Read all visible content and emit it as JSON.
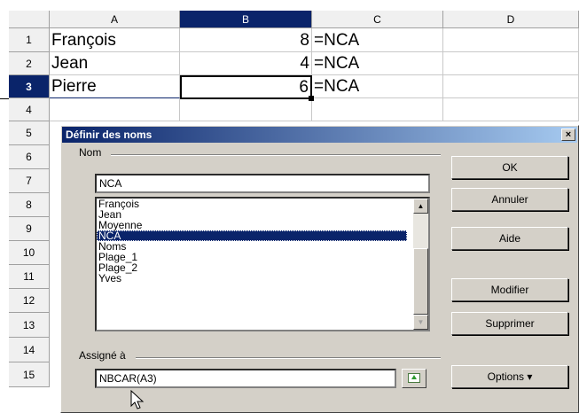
{
  "columns": [
    "A",
    "B",
    "C",
    "D"
  ],
  "rows": [
    "1",
    "2",
    "3",
    "4",
    "5",
    "6",
    "7",
    "8",
    "9",
    "10",
    "11",
    "12",
    "13",
    "14",
    "15"
  ],
  "cells": [
    {
      "a": "François",
      "b": "8",
      "c": "=NCA"
    },
    {
      "a": "Jean",
      "b": "4",
      "c": "=NCA"
    },
    {
      "a": "Pierre",
      "b": "6",
      "c": "=NCA"
    }
  ],
  "dialog": {
    "title": "Définir des noms",
    "close_glyph": "×",
    "name_group_label": "Nom",
    "name_value": "NCA",
    "names_list": [
      "François",
      "Jean",
      "Moyenne",
      "NCA",
      "Noms",
      "Plage_1",
      "Plage_2",
      "Yves"
    ],
    "selected_index": 3,
    "assigned_group_label": "Assigné à",
    "assigned_value": "NBCAR(A3)",
    "buttons": {
      "ok": "OK",
      "cancel": "Annuler",
      "help": "Aide",
      "modify": "Modifier",
      "delete": "Supprimer",
      "options": "Options ▾"
    }
  },
  "colors": {
    "selection": "#0a246a",
    "dialog_bg": "#d4d0c8"
  }
}
